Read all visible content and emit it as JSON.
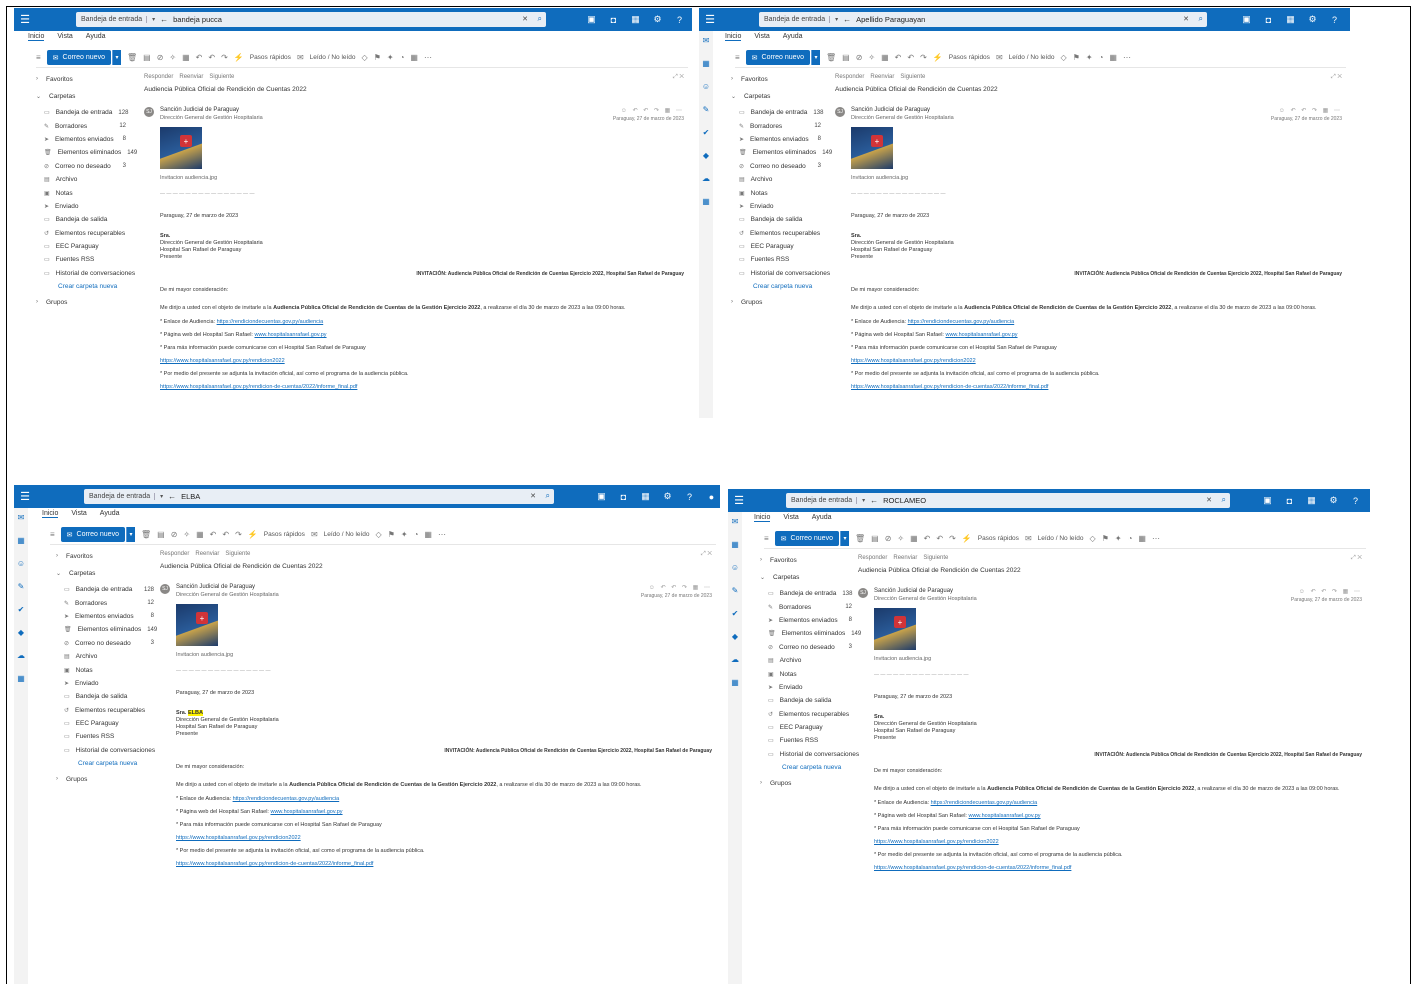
{
  "panels": [
    {
      "search_scope": "Bandeja de entrada",
      "search_query": "bandeja pucca",
      "folder_counts": [
        "128",
        "12",
        "8",
        "149",
        "3"
      ],
      "sender": "Sanción Judicial de Paraguay",
      "recipient_name": "",
      "subject_line": "INVITACIÓN: Audiencia Pública Oficial de Rendición de Cuentas Ejercicio 2022, Hospital San Rafael de Paraguay"
    },
    {
      "search_scope": "Bandeja de entrada",
      "search_query": "Apellido Paraguayan",
      "folder_counts": [
        "138",
        "12",
        "8",
        "149",
        "3"
      ],
      "sender": "Sanción Judicial de Paraguay",
      "recipient_name": "",
      "subject_line": "INVITACIÓN: Audiencia Pública Oficial de Rendición de Cuentas Ejercicio 2022, Hospital San Rafael de Paraguay"
    },
    {
      "search_scope": "Bandeja de entrada",
      "search_query": "ELBA",
      "folder_counts": [
        "128",
        "12",
        "8",
        "149",
        "3"
      ],
      "sender": "Sanción Judicial de Paraguay",
      "recipient_name": "ELBA",
      "subject_line": "INVITACIÓN: Audiencia Pública Oficial de Rendición de Cuentas Ejercicio 2022, Hospital San Rafael de Paraguay"
    },
    {
      "search_scope": "Bandeja de entrada",
      "search_query": "ROCLAMEO",
      "folder_counts": [
        "138",
        "12",
        "8",
        "149",
        "3"
      ],
      "sender": "Sanción Judicial de Paraguay",
      "recipient_name": "",
      "subject_line": "INVITACIÓN: Audiencia Pública Oficial de Rendición de Cuentas Ejercicio 2022, Hospital San Rafael de Paraguay"
    }
  ],
  "common": {
    "menu": [
      "Inicio",
      "Vista",
      "Ayuda"
    ],
    "new_mail": "Correo nuevo",
    "quick_steps": "Pasos rápidos",
    "read_unread": "Leído / No leído",
    "favorites": "Favoritos",
    "folders": "Carpetas",
    "groups": "Grupos",
    "folder_names": [
      "Bandeja de entrada",
      "Borradores",
      "Elementos enviados",
      "Elementos eliminados",
      "Correo no deseado",
      "Archivo",
      "Notas",
      "Enviado",
      "Bandeja de salida",
      "Elementos recuperables",
      "EEC Paraguay",
      "Fuentes RSS",
      "Historial de conversaciones"
    ],
    "create_folder": "Crear carpeta nueva",
    "reply_actions": [
      "Responder",
      "Reenviar",
      "Siguiente"
    ],
    "mail_subject": "Audiencia Pública Oficial de Rendición de Cuentas 2022",
    "attachment": "Invitacion audiencia.jpg",
    "greeting": "Paraguay, 27 de marzo de 2023",
    "addr_prefix": "Sra.",
    "addr_title": "Dirección General de Gestión Hospitalaria",
    "addr_org": "Hospital San Rafael de Paraguay",
    "addr_city": "Presente",
    "salutation": "De mi mayor consideración:",
    "para1_start": "Me dirijo a usted con el objeto de invitarle a la",
    "para1_bold": "Audiencia Pública Oficial de Rendición de Cuentas de la Gestión Ejercicio 2022",
    "para1_end": ", a realizarse el día 30 de marzo de 2023 a las 09:00 horas.",
    "bullet1_label": "* Enlace de Audiencia:",
    "bullet1_link": "https://rendiciondecuentas.gov.py/audiencia",
    "bullet2_label": "* Página web del Hospital San Rafael:",
    "bullet2_link": "www.hospitalsanrafael.gov.py",
    "bullet3": "* Para más información puede comunicarse con el Hospital San Rafael de Paraguay",
    "link3": "https://www.hospitalsanrafael.gov.py/rendicion2022",
    "para2": "* Por medio del presente se adjunta la invitación oficial, así como el programa de la audiencia pública.",
    "link4": "https://www.hospitalsanrafael.gov.py/rendicion-de-cuentas/2022/informe_final.pdf"
  }
}
